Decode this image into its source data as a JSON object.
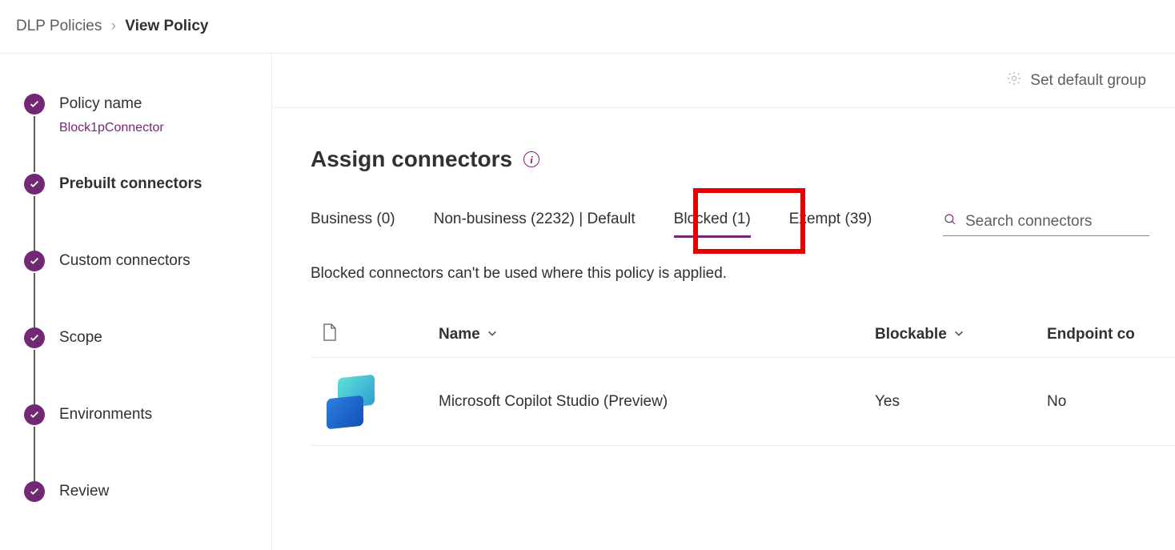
{
  "breadcrumb": {
    "parent": "DLP Policies",
    "current": "View Policy"
  },
  "sidebar": {
    "steps": [
      {
        "label": "Policy name",
        "sub": "Block1pConnector",
        "bold": false
      },
      {
        "label": "Prebuilt connectors",
        "sub": "",
        "bold": true
      },
      {
        "label": "Custom connectors",
        "sub": "",
        "bold": false
      },
      {
        "label": "Scope",
        "sub": "",
        "bold": false
      },
      {
        "label": "Environments",
        "sub": "",
        "bold": false
      },
      {
        "label": "Review",
        "sub": "",
        "bold": false
      }
    ]
  },
  "toolbar": {
    "set_default_label": "Set default group"
  },
  "main": {
    "title": "Assign connectors",
    "tabs": [
      {
        "label": "Business (0)",
        "active": false
      },
      {
        "label": "Non-business (2232) | Default",
        "active": false
      },
      {
        "label": "Blocked (1)",
        "active": true
      },
      {
        "label": "Exempt (39)",
        "active": false
      }
    ],
    "search_placeholder": "Search connectors",
    "tab_description": "Blocked connectors can't be used where this policy is applied.",
    "columns": {
      "name": "Name",
      "blockable": "Blockable",
      "endpoint": "Endpoint co"
    },
    "rows": [
      {
        "name": "Microsoft Copilot Studio (Preview)",
        "blockable": "Yes",
        "endpoint": "No"
      }
    ]
  }
}
